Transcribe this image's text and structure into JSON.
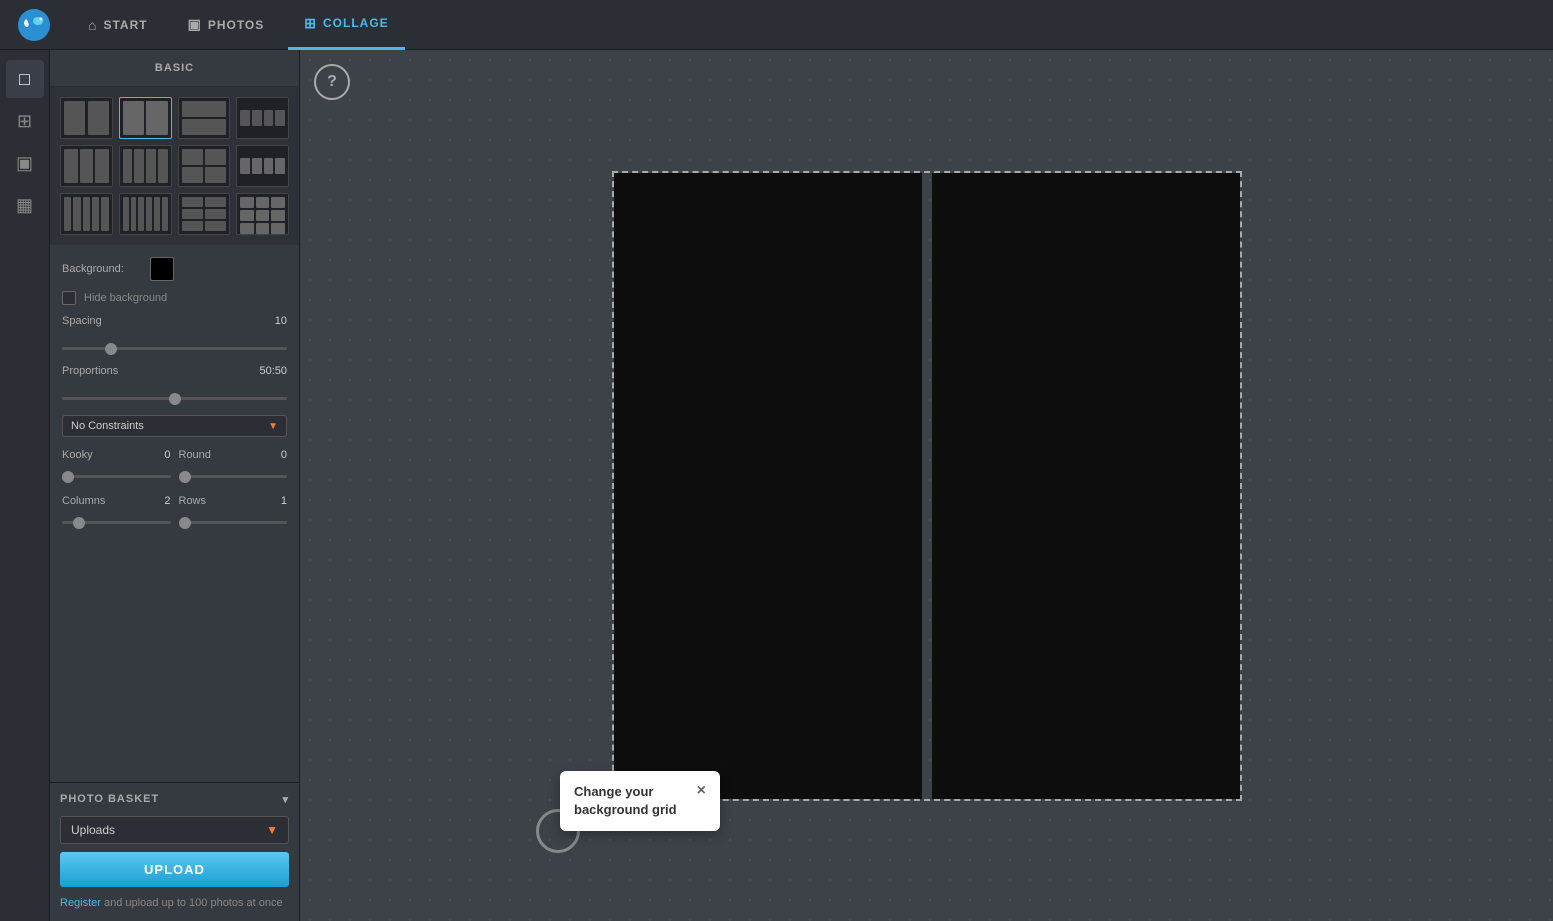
{
  "app": {
    "logo_char": "🐦",
    "nav_items": [
      {
        "id": "start",
        "label": "START",
        "icon": "⌂",
        "active": false
      },
      {
        "id": "photos",
        "label": "PHOTOS",
        "icon": "▣",
        "active": false
      },
      {
        "id": "collage",
        "label": "COLLAGE",
        "icon": "⊞",
        "active": true
      }
    ]
  },
  "icon_sidebar": {
    "items": [
      {
        "id": "square",
        "icon": "□",
        "active": true
      },
      {
        "id": "grid4",
        "icon": "⊞",
        "active": false
      },
      {
        "id": "grid2",
        "icon": "▣",
        "active": false
      },
      {
        "id": "layout",
        "icon": "▦",
        "active": false
      }
    ]
  },
  "left_panel": {
    "header": "BASIC",
    "background_label": "Background:",
    "background_color": "#000000",
    "hide_background_label": "Hide background",
    "spacing_label": "Spacing",
    "spacing_value": "10",
    "proportions_label": "Proportions",
    "proportions_value": "50:50",
    "no_constraints_label": "No Constraints",
    "kooky_label": "Kooky",
    "kooky_value": "0",
    "round_label": "Round",
    "round_value": "0",
    "columns_label": "Columns",
    "columns_value": "2",
    "rows_label": "Rows",
    "rows_value": "1"
  },
  "photo_basket": {
    "header": "PHOTO BASKET",
    "dropdown_label": "Uploads",
    "upload_button": "UPLOAD",
    "register_text": "Register",
    "register_suffix": " and upload up to 100 photos at once"
  },
  "tooltip": {
    "text": "Change your background grid",
    "close_char": "×"
  }
}
